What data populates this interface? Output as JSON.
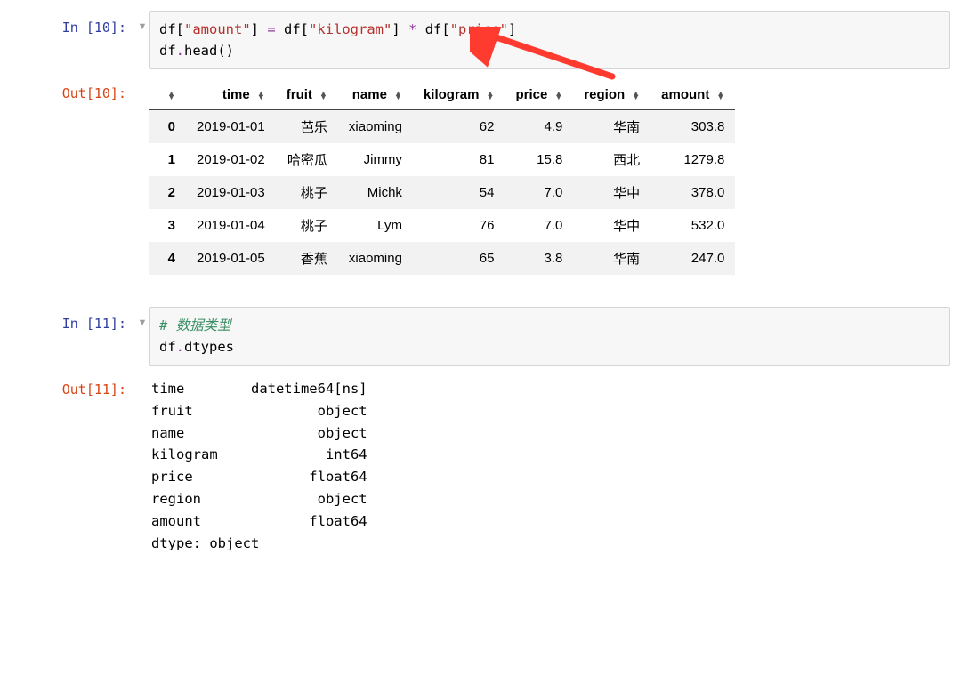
{
  "cell1": {
    "in_prompt": "In [10]:",
    "out_prompt": "Out[10]:",
    "code_tokens": [
      {
        "t": "name",
        "v": "df"
      },
      {
        "t": "plain",
        "v": "["
      },
      {
        "t": "str",
        "v": "\"amount\""
      },
      {
        "t": "plain",
        "v": "] "
      },
      {
        "t": "op",
        "v": "="
      },
      {
        "t": "plain",
        "v": " df["
      },
      {
        "t": "str",
        "v": "\"kilogram\""
      },
      {
        "t": "plain",
        "v": "] "
      },
      {
        "t": "op",
        "v": "*"
      },
      {
        "t": "plain",
        "v": " df["
      },
      {
        "t": "str",
        "v": "\"price\""
      },
      {
        "t": "plain",
        "v": "]\n"
      },
      {
        "t": "name",
        "v": "df"
      },
      {
        "t": "op",
        "v": "."
      },
      {
        "t": "name",
        "v": "head"
      },
      {
        "t": "plain",
        "v": "()"
      }
    ],
    "table": {
      "columns": [
        "",
        "time",
        "fruit",
        "name",
        "kilogram",
        "price",
        "region",
        "amount"
      ],
      "rows": [
        {
          "idx": "0",
          "cells": [
            "2019-01-01",
            "芭乐",
            "xiaoming",
            "62",
            "4.9",
            "华南",
            "303.8"
          ]
        },
        {
          "idx": "1",
          "cells": [
            "2019-01-02",
            "哈密瓜",
            "Jimmy",
            "81",
            "15.8",
            "西北",
            "1279.8"
          ]
        },
        {
          "idx": "2",
          "cells": [
            "2019-01-03",
            "桃子",
            "Michk",
            "54",
            "7.0",
            "华中",
            "378.0"
          ]
        },
        {
          "idx": "3",
          "cells": [
            "2019-01-04",
            "桃子",
            "Lym",
            "76",
            "7.0",
            "华中",
            "532.0"
          ]
        },
        {
          "idx": "4",
          "cells": [
            "2019-01-05",
            "香蕉",
            "xiaoming",
            "65",
            "3.8",
            "华南",
            "247.0"
          ]
        }
      ]
    }
  },
  "cell2": {
    "in_prompt": "In [11]:",
    "out_prompt": "Out[11]:",
    "code_tokens": [
      {
        "t": "comment",
        "v": "# 数据类型"
      },
      {
        "t": "plain",
        "v": "\n"
      },
      {
        "t": "name",
        "v": "df"
      },
      {
        "t": "op",
        "v": "."
      },
      {
        "t": "name",
        "v": "dtypes"
      }
    ],
    "dtypes_lines": [
      [
        "time",
        "datetime64[ns]"
      ],
      [
        "fruit",
        "object"
      ],
      [
        "name",
        "object"
      ],
      [
        "kilogram",
        "int64"
      ],
      [
        "price",
        "float64"
      ],
      [
        "region",
        "object"
      ],
      [
        "amount",
        "float64"
      ]
    ],
    "dtypes_footer": "dtype: object"
  },
  "collapse_glyph": "▼"
}
